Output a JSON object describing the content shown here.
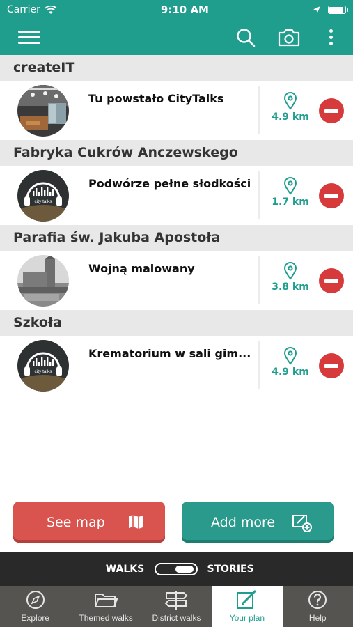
{
  "status": {
    "carrier": "Carrier",
    "time": "9:10 AM",
    "battery_level": 0.95
  },
  "header": {
    "icons": {
      "menu": "hamburger-menu-icon",
      "search": "search-icon",
      "camera": "camera-icon",
      "more": "more-vertical-icon"
    },
    "brand_color": "#1f9e8e"
  },
  "plan": [
    {
      "section": "createIT",
      "title": "Tu powstało CityTalks",
      "distance": "4.9 km",
      "thumb": "office-photo"
    },
    {
      "section": "Fabryka Cukrów Anczewskego",
      "title": "Podwórze pełne słodkości",
      "distance": "1.7 km",
      "thumb": "citytalks-logo"
    },
    {
      "section": "Parafia św. Jakuba Apostoła",
      "title": "Wojną malowany",
      "distance": "3.8 km",
      "thumb": "church-photo"
    },
    {
      "section": "Szkoła",
      "title": "Krematorium w sali gim...",
      "distance": "4.9 km",
      "thumb": "citytalks-logo"
    }
  ],
  "logo_text": "city talks",
  "buttons": {
    "see_map": "See map",
    "add_more": "Add more"
  },
  "mode": {
    "left": "WALKS",
    "right": "STORIES",
    "selected": "STORIES"
  },
  "tabs": [
    {
      "label": "Explore",
      "icon": "compass-icon"
    },
    {
      "label": "Themed walks",
      "icon": "folder-icon"
    },
    {
      "label": "District walks",
      "icon": "signpost-icon"
    },
    {
      "label": "Your plan",
      "icon": "edit-plan-icon",
      "active": true
    },
    {
      "label": "Help",
      "icon": "help-icon"
    }
  ],
  "colors": {
    "remove": "#d73a3a",
    "see_map": "#d9534f",
    "add_more": "#2a9a8c",
    "tab_bar": "#555451",
    "mode_bar": "#292929"
  }
}
